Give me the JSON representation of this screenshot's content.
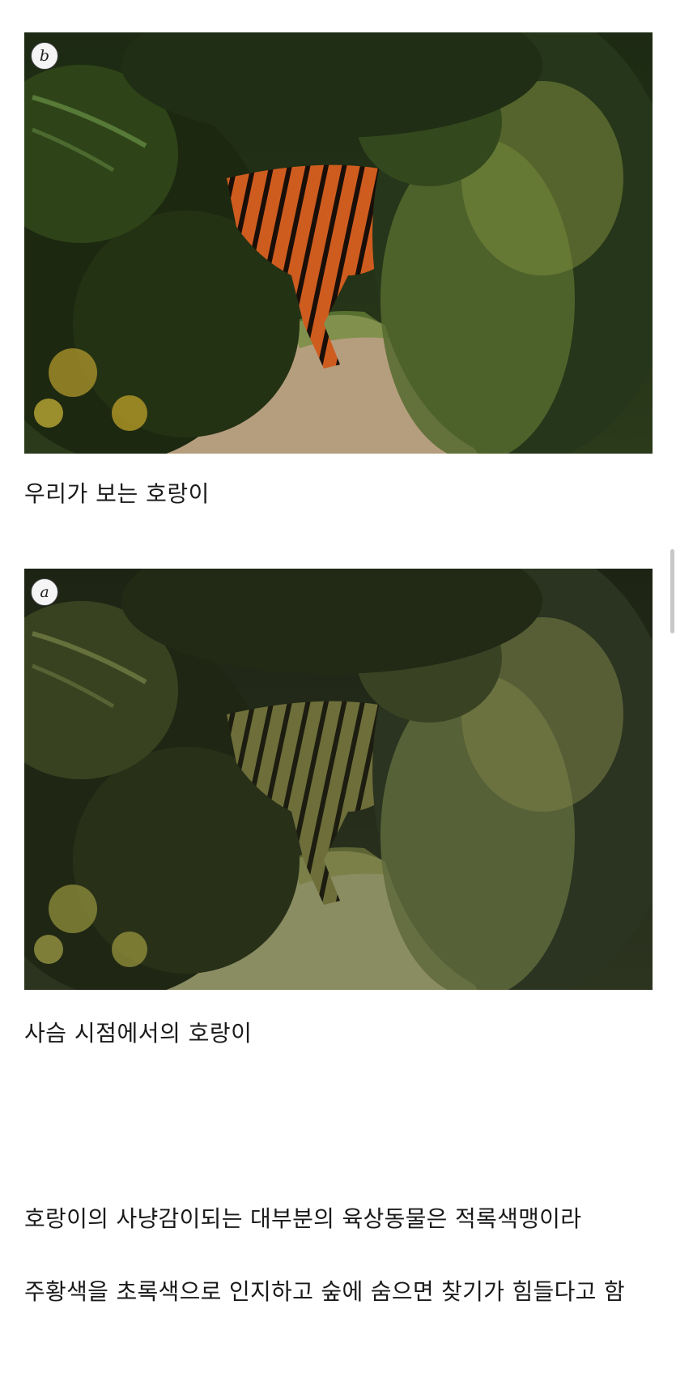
{
  "figures": [
    {
      "panel_label": "b",
      "caption": "우리가 보는 호랑이"
    },
    {
      "panel_label": "a",
      "caption": "사슴 시점에서의 호랑이"
    }
  ],
  "paragraphs": [
    "호랑이의 사냥감이되는 대부분의 육상동물은 적록색맹이라",
    "주황색을 초록색으로 인지하고 숲에 숨으면 찾기가 힘들다고 함"
  ],
  "colors": {
    "tiger_human_view": "#c8581e",
    "tiger_deer_view": "#6e6e3a",
    "foliage_dark": "#1e2a12",
    "path_human_view": "#b59e7e",
    "path_deer_view": "#8a8c62"
  }
}
